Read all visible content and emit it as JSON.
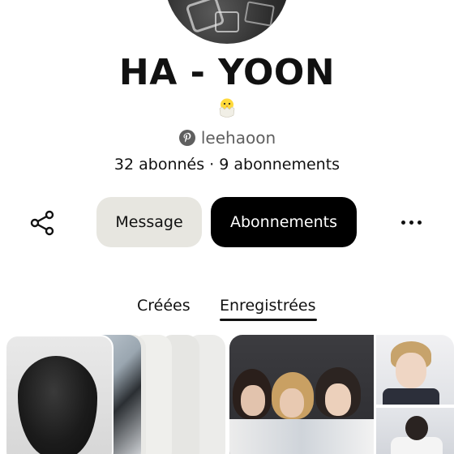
{
  "profile": {
    "name": "HA - YOON",
    "emoji": "🐣",
    "emoji_icon": "hatching-chick-icon",
    "handle": "leehaoon",
    "stats": "32 abonnés · 9 abonnements"
  },
  "actions": {
    "share_icon": "share-icon",
    "message_label": "Message",
    "follow_label": "Abonnements",
    "more_icon": "more-horizontal-icon"
  },
  "tabs": [
    {
      "label": "Créées",
      "active": false
    },
    {
      "label": "Enregistrées",
      "active": true
    }
  ],
  "colors": {
    "accent": "#000000",
    "secondary_button": "#e7e6e0",
    "muted_text": "#5f5f5f"
  }
}
